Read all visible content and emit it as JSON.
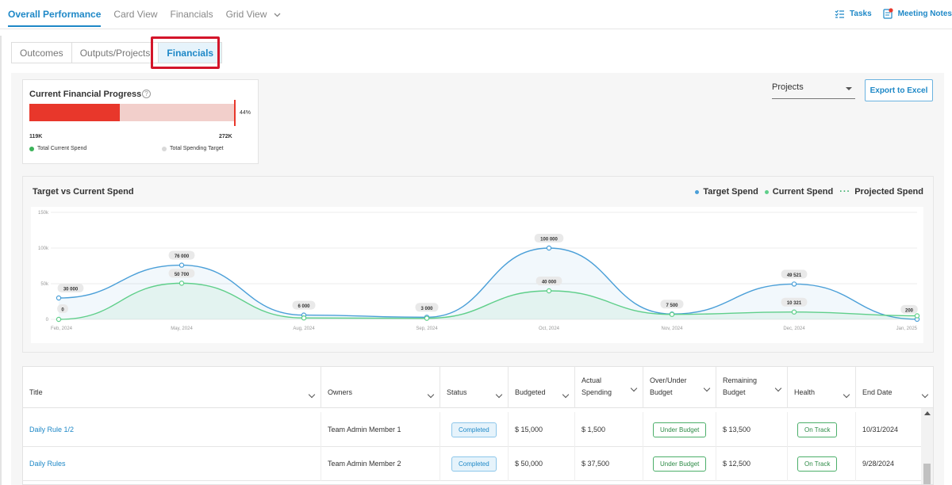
{
  "topnav": {
    "tabs": [
      "Overall Performance",
      "Card View",
      "Financials",
      "Grid View"
    ],
    "tasks_label": "Tasks",
    "meeting_notes_label": "Meeting Notes"
  },
  "subtabs": [
    "Outcomes",
    "Outputs/Projects",
    "Financials"
  ],
  "progress": {
    "title": "Current Financial Progress",
    "help": "?",
    "percent_label": "44%",
    "fraction": 0.44,
    "current_label": "119K",
    "target_label": "272K",
    "legend_current": "Total Current Spend",
    "legend_target": "Total Spending Target"
  },
  "controls": {
    "select_value": "Projects",
    "export_label": "Export to Excel"
  },
  "chart": {
    "title": "Target vs Current Spend",
    "legend": [
      "Target Spend",
      "Current Spend",
      "Projected Spend"
    ],
    "colors": {
      "target": "#4a9fd8",
      "current": "#5fcf8a",
      "projected": "#3aaf6a"
    }
  },
  "chart_data": {
    "type": "line",
    "title": "Target vs Current Spend",
    "categories": [
      "Feb, 2024",
      "May, 2024",
      "Aug, 2024",
      "Sep, 2024",
      "Oct, 2024",
      "Nov, 2024",
      "Dec, 2024",
      "Jan, 2025"
    ],
    "ylim": [
      0,
      150000
    ],
    "yticks": [
      "0",
      "50k",
      "100k",
      "150k"
    ],
    "grid": true,
    "legend_position": "top-right",
    "series": [
      {
        "name": "Target Spend",
        "values": [
          30000,
          76000,
          6000,
          3000,
          100000,
          7500,
          49521,
          200
        ],
        "labels": [
          "30 000",
          "76 000",
          "6 000",
          "3 000",
          "100 000",
          "7 500",
          "49 521",
          "200"
        ]
      },
      {
        "name": "Current Spend",
        "values": [
          0,
          50700,
          2000,
          1500,
          40000,
          7000,
          10321,
          5000
        ],
        "labels": [
          "0",
          "50 700",
          "",
          "",
          "40 000",
          "",
          "10 321",
          ""
        ]
      }
    ]
  },
  "table": {
    "headers": [
      "Title",
      "Owners",
      "Status",
      "Budgeted",
      "Actual\nSpending",
      "Over/Under\nBudget",
      "Remaining\nBudget",
      "Health",
      "End Date"
    ],
    "rows": [
      {
        "title": "Daily Rule 1/2",
        "owner": "Team Admin Member 1",
        "status": "Completed",
        "budgeted": "$ 15,000",
        "actual": "$ 1,500",
        "overunder": "Under Budget",
        "remaining": "$ 13,500",
        "health": "On Track",
        "end": "10/31/2024"
      },
      {
        "title": "Daily Rules",
        "owner": "Team Admin Member 2",
        "status": "Completed",
        "budgeted": "$ 50,000",
        "actual": "$ 37,500",
        "overunder": "Under Budget",
        "remaining": "$ 12,500",
        "health": "On Track",
        "end": "9/28/2024"
      }
    ]
  }
}
